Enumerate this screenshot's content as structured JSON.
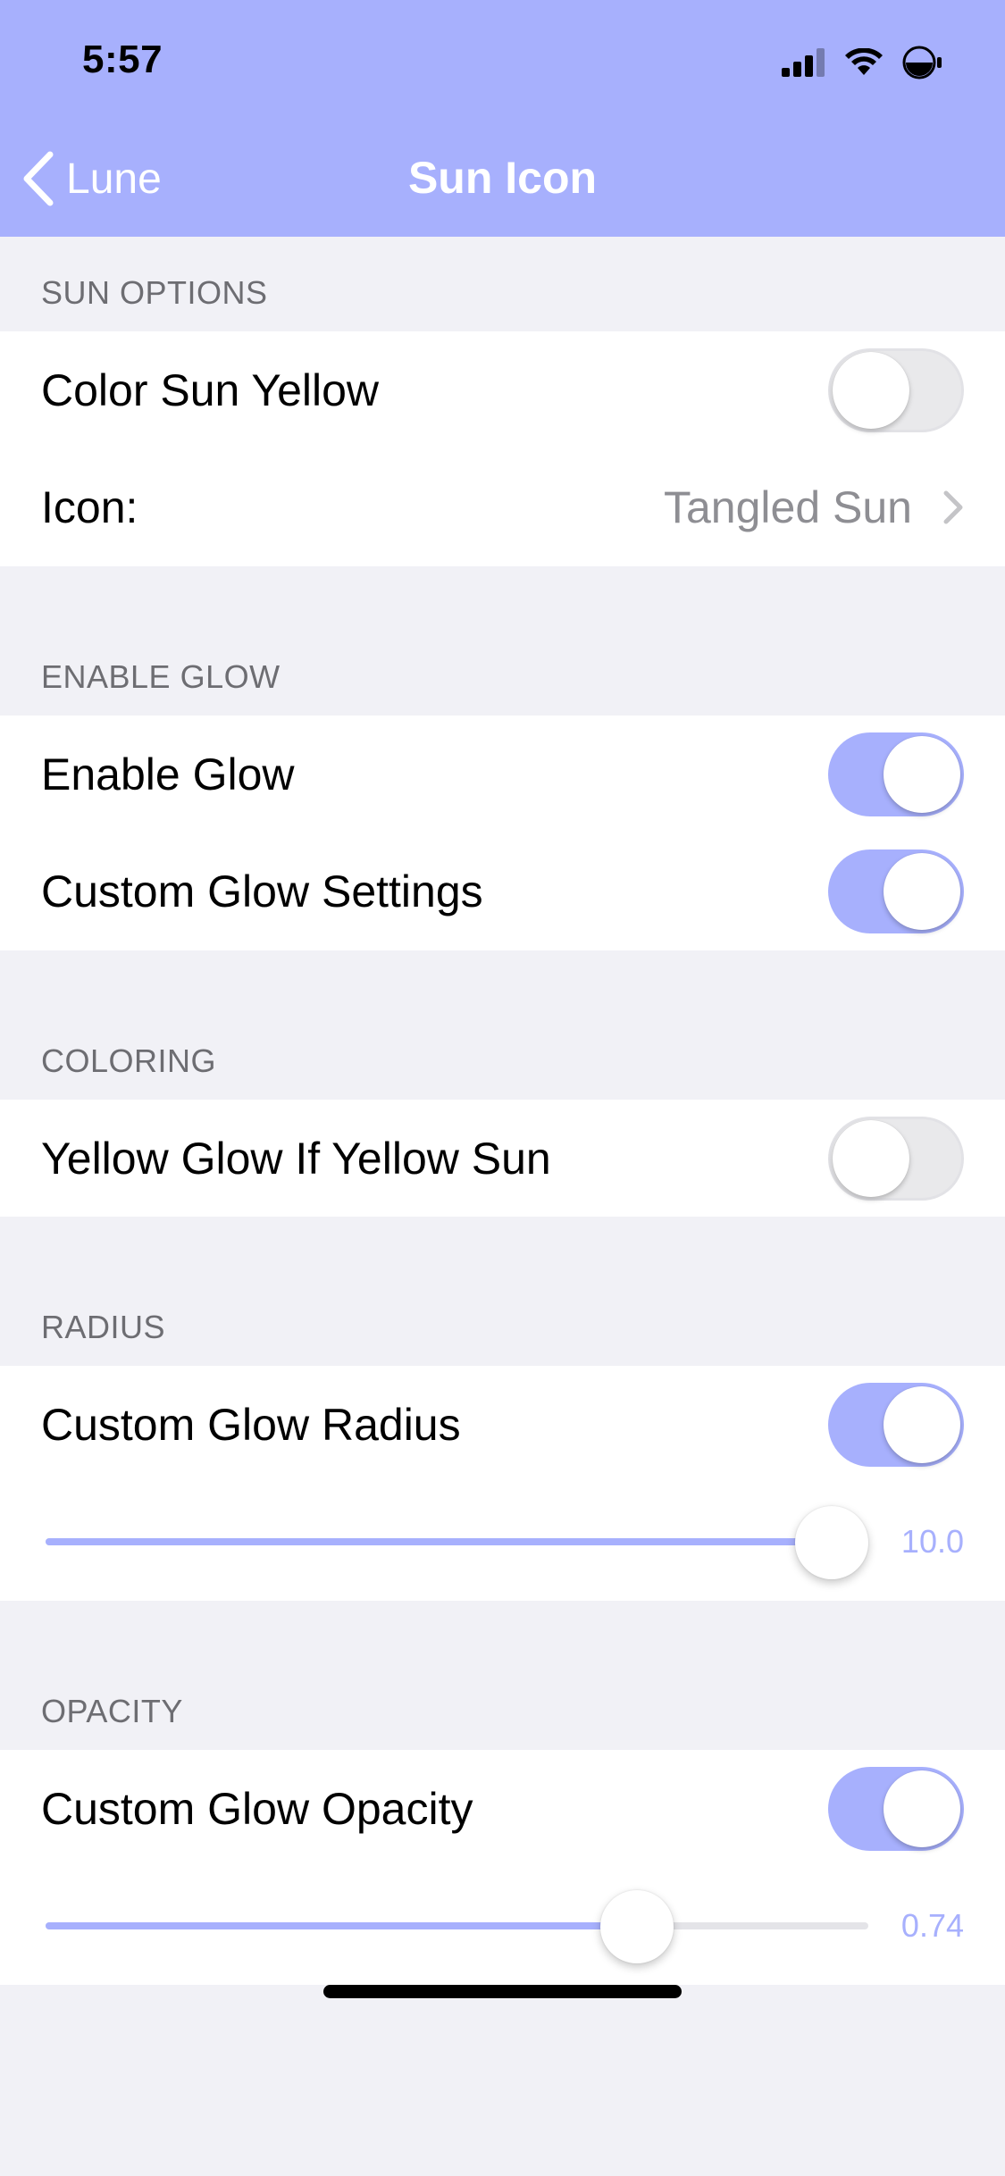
{
  "status_bar": {
    "time": "5:57",
    "icons": [
      "cellular-signal-icon",
      "wifi-icon",
      "low-power-battery-icon"
    ]
  },
  "nav": {
    "back_label": "Lune",
    "title": "Sun Icon"
  },
  "colors": {
    "accent": "#a7b0fd",
    "background": "#f1f1f6",
    "section_header": "#6d6d72",
    "secondary_text": "#8e8e93"
  },
  "sections": {
    "sun_options": {
      "header": "SUN OPTIONS",
      "color_sun_yellow": {
        "label": "Color Sun Yellow",
        "on": false
      },
      "icon": {
        "label": "Icon:",
        "value": "Tangled Sun"
      }
    },
    "enable_glow": {
      "header": "ENABLE GLOW",
      "enable_glow": {
        "label": "Enable Glow",
        "on": true
      },
      "custom_glow_settings": {
        "label": "Custom Glow Settings",
        "on": true
      }
    },
    "coloring": {
      "header": "COLORING",
      "yellow_glow": {
        "label": "Yellow Glow If Yellow Sun",
        "on": false
      }
    },
    "radius": {
      "header": "RADIUS",
      "custom_glow_radius": {
        "label": "Custom Glow Radius",
        "on": true
      },
      "slider": {
        "value": "10.0",
        "fraction": 1.0
      }
    },
    "opacity": {
      "header": "OPACITY",
      "custom_glow_opacity": {
        "label": "Custom Glow Opacity",
        "on": true
      },
      "slider": {
        "value": "0.74",
        "fraction": 0.74
      }
    }
  }
}
